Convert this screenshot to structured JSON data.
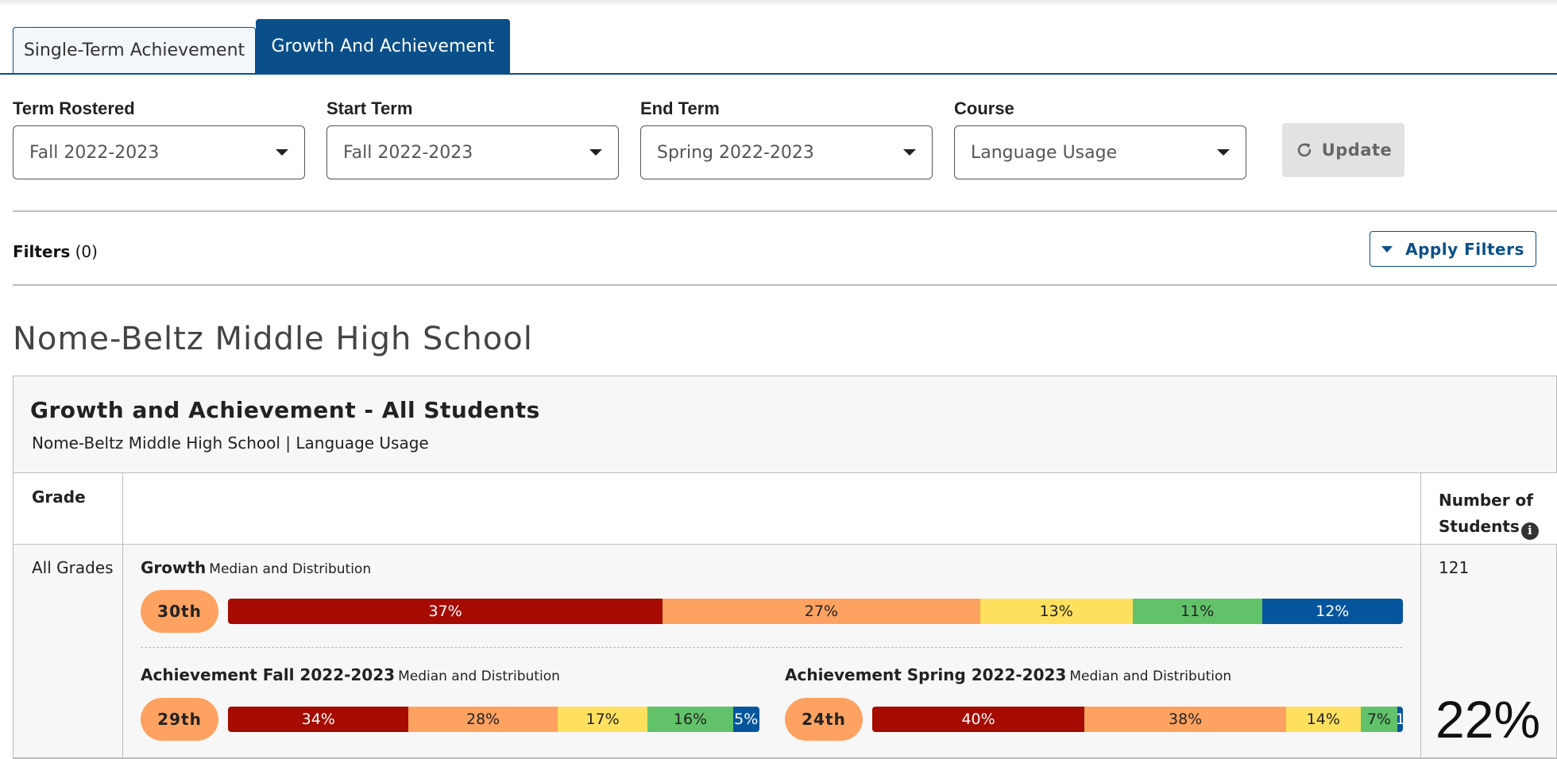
{
  "tabs": [
    {
      "label": "Single-Term Achievement",
      "active": false
    },
    {
      "label": "Growth And Achievement",
      "active": true
    }
  ],
  "selectors": {
    "term_rostered": {
      "label": "Term Rostered",
      "value": "Fall 2022-2023"
    },
    "start_term": {
      "label": "Start Term",
      "value": "Fall 2022-2023"
    },
    "end_term": {
      "label": "End Term",
      "value": "Spring 2022-2023"
    },
    "course": {
      "label": "Course",
      "value": "Language Usage"
    }
  },
  "update_button": {
    "label": "Update",
    "icon": "refresh-icon"
  },
  "filters": {
    "label": "Filters",
    "count": "(0)"
  },
  "apply_filters_button": {
    "label": "Apply Filters",
    "icon": "caret-down-icon"
  },
  "school_title": "Nome-Beltz Middle High School",
  "report": {
    "title": "Growth and Achievement - All Students",
    "subtitle": "Nome-Beltz Middle High School | Language Usage",
    "columns": {
      "grade": "Grade",
      "num_students": "Number of Students",
      "info_icon": "info-icon"
    },
    "row": {
      "grade": "All Grades",
      "num_students": "121",
      "growth": {
        "label": "Growth",
        "sublabel": "Median and Distribution",
        "median": "30th",
        "distribution": [
          {
            "label": "37%",
            "value": 37,
            "color": "#a50b00",
            "text": "#ffffff"
          },
          {
            "label": "27%",
            "value": 27,
            "color": "#fea261",
            "text": "#222222"
          },
          {
            "label": "13%",
            "value": 13,
            "color": "#fde05e",
            "text": "#222222"
          },
          {
            "label": "11%",
            "value": 11,
            "color": "#62c26a",
            "text": "#222222"
          },
          {
            "label": "12%",
            "value": 12,
            "color": "#05559d",
            "text": "#ffffff"
          }
        ]
      },
      "achievement_fall": {
        "label": "Achievement Fall 2022-2023",
        "sublabel": "Median and Distribution",
        "median": "29th",
        "distribution": [
          {
            "label": "34%",
            "value": 34,
            "color": "#a50b00",
            "text": "#ffffff"
          },
          {
            "label": "28%",
            "value": 28,
            "color": "#fea261",
            "text": "#222222"
          },
          {
            "label": "17%",
            "value": 17,
            "color": "#fde05e",
            "text": "#222222"
          },
          {
            "label": "16%",
            "value": 16,
            "color": "#62c26a",
            "text": "#222222"
          },
          {
            "label": "5%",
            "value": 5,
            "color": "#05559d",
            "text": "#ffffff"
          }
        ]
      },
      "achievement_spring": {
        "label": "Achievement Spring 2022-2023",
        "sublabel": "Median and Distribution",
        "median": "24th",
        "distribution": [
          {
            "label": "40%",
            "value": 40,
            "color": "#a50b00",
            "text": "#ffffff"
          },
          {
            "label": "38%",
            "value": 38,
            "color": "#fea261",
            "text": "#222222"
          },
          {
            "label": "14%",
            "value": 14,
            "color": "#fde05e",
            "text": "#222222"
          },
          {
            "label": "7%",
            "value": 7,
            "color": "#62c26a",
            "text": "#222222"
          },
          {
            "label": "1",
            "value": 1,
            "color": "#05559d",
            "text": "#ffffff"
          }
        ]
      },
      "big_percent": "22%"
    }
  }
}
